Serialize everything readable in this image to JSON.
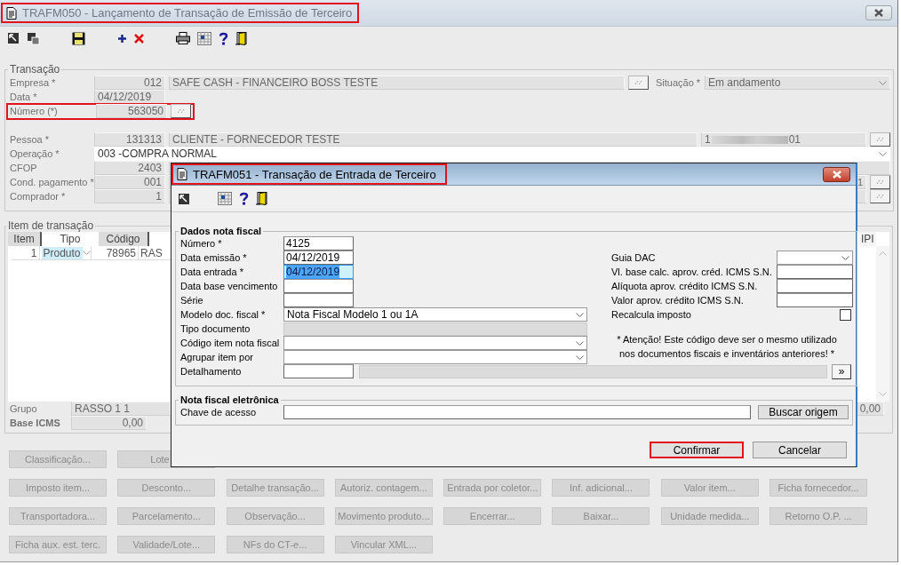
{
  "main_window": {
    "title": "TRAFM050 - Lançamento de Transação de Emissão de Terceiro",
    "highlighted": true
  },
  "transacao": {
    "legend": "Transação",
    "empresa": {
      "label": "Empresa *",
      "code": "012",
      "name": "SAFE CASH - FINANCEIRO BOSS TESTE"
    },
    "situacao": {
      "label": "Situação *",
      "value": "Em andamento"
    },
    "data": {
      "label": "Data *",
      "value": "04/12/2019"
    },
    "numero": {
      "label": "Número (*)",
      "value": "563050",
      "highlighted": true
    },
    "pessoa": {
      "label": "Pessoa *",
      "code": "131313",
      "name": "CLIENTE - FORNECEDOR TESTE",
      "document_start": "1",
      "document_end": "01"
    },
    "operacao": {
      "label": "Operação *",
      "value": "003 -COMPRA NORMAL"
    },
    "cfop": {
      "label": "CFOP",
      "value": "2403"
    },
    "cond_pagamento": {
      "label": "Cond. pagamento *",
      "value": "001",
      "side_value": "1"
    },
    "comprador": {
      "label": "Comprador *",
      "value": "1"
    }
  },
  "itens": {
    "legend": "Item de transação",
    "columns": [
      {
        "label": "Item",
        "selected": false
      },
      {
        "label": "Tipo",
        "selected": true
      },
      {
        "label": "Código",
        "selected": false
      }
    ],
    "last_column": "IPI",
    "rows": [
      {
        "item": "1",
        "tipo": "Produto",
        "codigo": "78965",
        "column_4": "RAS"
      }
    ],
    "grupo": {
      "label": "Grupo",
      "value": "RASSO 1 1"
    },
    "base_icms": {
      "label": "Base ICMS",
      "value": "0,00"
    },
    "side_total": "0,00"
  },
  "actions": [
    [
      {
        "label": "Classificação...",
        "disabled": true
      },
      {
        "label": "Lote",
        "disabled": true,
        "kind": "covered"
      }
    ],
    [
      {
        "label": "Imposto item...",
        "disabled": true
      },
      {
        "label": "Desconto...",
        "disabled": true
      },
      {
        "label": "Detalhe transação...",
        "disabled": true
      },
      {
        "label": "Autoriz. contagem...",
        "disabled": true
      },
      {
        "label": "Entrada por coletor...",
        "disabled": true
      },
      {
        "label": "Inf. adicional...",
        "disabled": true
      },
      {
        "label": "Valor item...",
        "disabled": true
      },
      {
        "label": "Ficha fornecedor...",
        "disabled": true
      }
    ],
    [
      {
        "label": "Transportadora...",
        "disabled": true
      },
      {
        "label": "Parcelamento...",
        "disabled": true
      },
      {
        "label": "Observação...",
        "disabled": true
      },
      {
        "label": "Movimento produto...",
        "disabled": true
      },
      {
        "label": "Encerrar...",
        "disabled": true
      },
      {
        "label": "Baixar...",
        "disabled": true
      },
      {
        "label": "Unidade medida...",
        "disabled": true
      },
      {
        "label": "Retorno O.P. ...",
        "disabled": true
      }
    ],
    [
      {
        "label": "Ficha aux. est. terc.",
        "disabled": true
      },
      {
        "label": "Validade/Lote...",
        "disabled": true
      },
      {
        "label": "NFs do CT-e...",
        "disabled": true
      },
      {
        "label": "Vincular XML...",
        "disabled": true
      }
    ]
  ],
  "dialog": {
    "title": "TRAFM051 - Transação de Entrada de Terceiro",
    "highlighted": true,
    "dados": {
      "legend": "Dados nota fiscal",
      "fields": [
        {
          "label": "Número *",
          "kind": "input",
          "value": "4125"
        },
        {
          "label": "Data emissão *",
          "kind": "input",
          "value": "04/12/2019"
        },
        {
          "label": "Data entrada *",
          "kind": "input",
          "value": "04/12/2019",
          "focused": true
        },
        {
          "label": "Data base vencimento",
          "kind": "input"
        },
        {
          "label": "Série",
          "kind": "input"
        },
        {
          "label": "Modelo doc. fiscal *",
          "kind": "combo",
          "value": "Nota Fiscal Modelo 1 ou 1A"
        },
        {
          "label": "Tipo documento",
          "kind": "readonly"
        },
        {
          "label": "Código item nota fiscal",
          "kind": "combo"
        },
        {
          "label": "Agrupar item por",
          "kind": "combo"
        }
      ],
      "right_fields": [
        {
          "label": "Guia DAC",
          "kind": "combo"
        },
        {
          "label": "Vl. base calc. aprov. créd. ICMS S.N.",
          "kind": "input"
        },
        {
          "label": "Alíquota aprov. crédito ICMS S.N.",
          "kind": "input"
        },
        {
          "label": "Valor aprov. crédito ICMS S.N.",
          "kind": "input"
        },
        {
          "label": "Recalcula imposto",
          "kind": "checkbox",
          "checked": false
        }
      ],
      "note": "* Atenção! Este código deve ser o mesmo utilizado nos documentos fiscais e inventários anteriores! *",
      "detalhamento": {
        "label": "Detalhamento",
        "button": "»"
      }
    },
    "nfe": {
      "legend": "Nota fiscal eletrônica",
      "label": "Chave de acesso",
      "button": "Buscar origem"
    },
    "buttons": [
      {
        "label": "Confirmar",
        "highlighted": true
      },
      {
        "label": "Cancelar",
        "highlighted": false
      }
    ]
  }
}
